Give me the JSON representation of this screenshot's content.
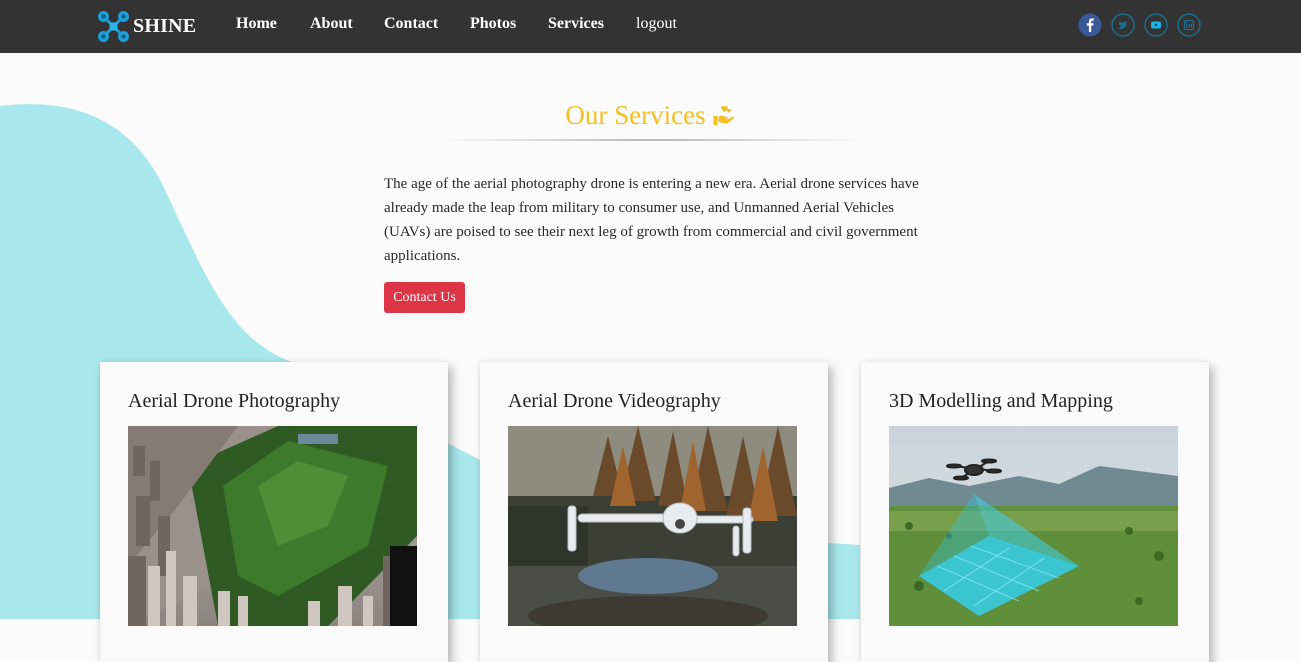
{
  "brand": {
    "name": "SHINE",
    "logo_icon": "drone-logo-icon"
  },
  "nav": {
    "items": [
      {
        "label": "Home"
      },
      {
        "label": "About"
      },
      {
        "label": "Contact"
      },
      {
        "label": "Photos"
      },
      {
        "label": "Services"
      },
      {
        "label": "logout"
      }
    ]
  },
  "social": [
    {
      "icon": "facebook-icon",
      "color": "#3b5998"
    },
    {
      "icon": "twitter-icon",
      "color": "#1da1f2"
    },
    {
      "icon": "vimeo-icon",
      "color": "#1ab7ea"
    },
    {
      "icon": "linkedin-icon",
      "color": "#0077b5"
    }
  ],
  "hero": {
    "title": "Our Services",
    "title_icon": "hand-heart-icon",
    "description": "The age of the aerial photography drone is entering a new era. Aerial drone services have already made the leap from military to consumer use, and Unmanned Aerial Vehicles (UAVs) are poised to see their next leg of growth from commercial and civil government applications.",
    "button_label": "Contact Us"
  },
  "cards": [
    {
      "title": "Aerial Drone Photography",
      "image": "city-park-aerial-photo"
    },
    {
      "title": "Aerial Drone Videography",
      "image": "drone-in-forest-photo"
    },
    {
      "title": "3D Modelling and Mapping",
      "image": "drone-mapping-field-photo"
    }
  ],
  "colors": {
    "navbar": "#333333",
    "accent_title": "#f5c022",
    "button": "#dc3545",
    "blob": "#a8e8ec",
    "page_background": "#fbfbfc"
  }
}
